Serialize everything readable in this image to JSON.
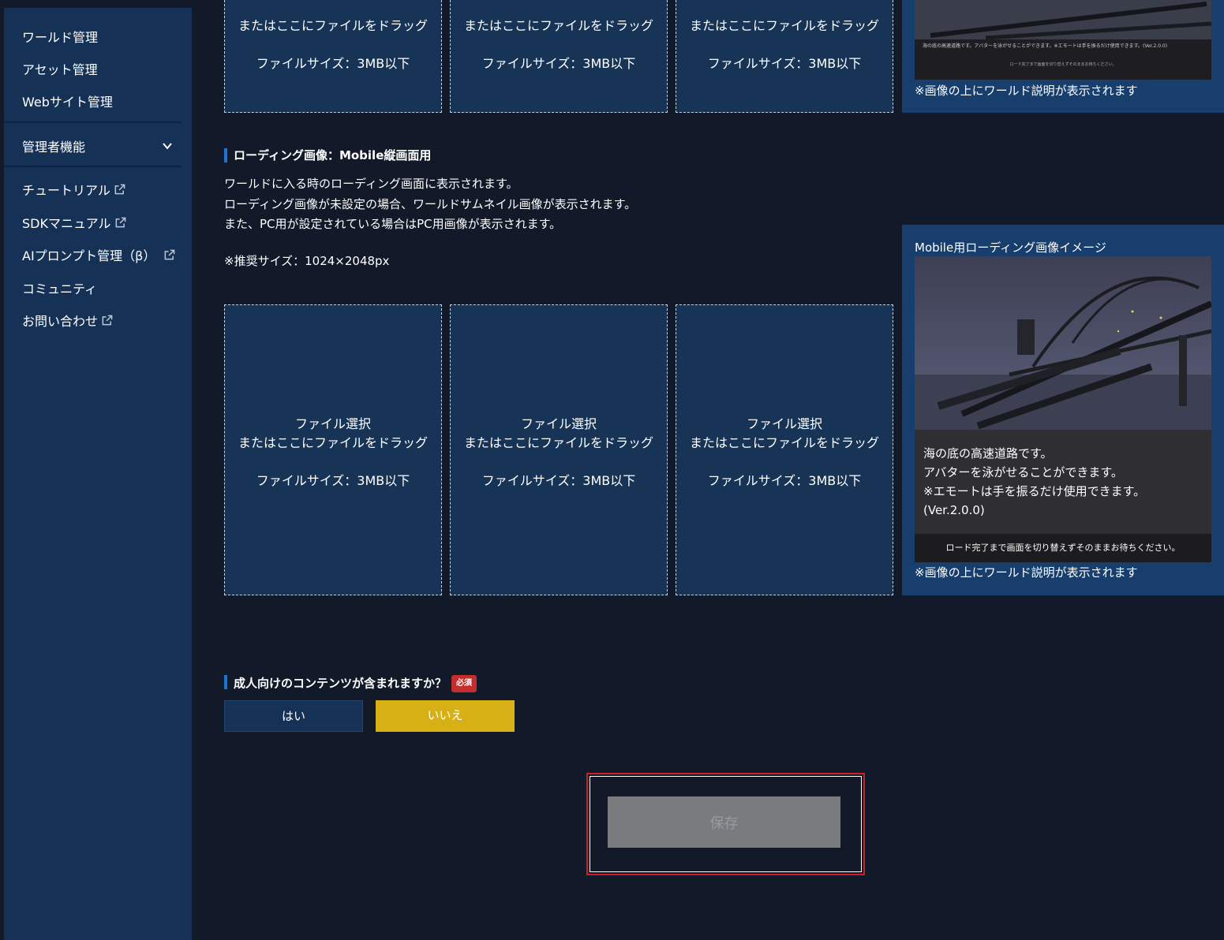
{
  "sidebar": {
    "items": [
      {
        "label": "ワールド管理"
      },
      {
        "label": "アセット管理"
      },
      {
        "label": "Webサイト管理"
      },
      {
        "label": "管理者機能"
      },
      {
        "label": "チュートリアル"
      },
      {
        "label": "SDKマニュアル"
      },
      {
        "label": "AIプロンプト管理（β）"
      },
      {
        "label": "コミュニティ"
      },
      {
        "label": "お問い合わせ"
      }
    ]
  },
  "upload": {
    "line1": "ファイル選択",
    "line2": "またはここにファイルをドラッグ",
    "size": "ファイルサイズ：3MB以下"
  },
  "top_preview": {
    "note": "※画像の上にワールド説明が表示されます",
    "tiny_text": "海の底の高速道路です。アバターを泳がせることができます。※エモートは手を振るだけ使用できます。(Ver.2.0.0)",
    "tiny_footer": "ロード完了まで画面を切り替えずそのままお待ちください。"
  },
  "mobile_section": {
    "title": "ローディング画像：Mobile縦画面用",
    "desc1": "ワールドに入る時のローディング画面に表示されます。",
    "desc2": "ローディング画像が未設定の場合、ワールドサムネイル画像が表示されます。",
    "desc3": "また、PC用が設定されている場合はPC用画像が表示されます。",
    "recommend": "※推奨サイズ：1024×2048px"
  },
  "mobile_preview": {
    "title": "Mobile用ローディング画像イメージ",
    "line1": "海の底の高速道路です。",
    "line2": "アバターを泳がせることができます。",
    "line3": "※エモートは手を振るだけ使用できます。",
    "line4": "(Ver.2.0.0)",
    "footer": "ロード完了まで画面を切り替えずそのままお待ちください。",
    "note": "※画像の上にワールド説明が表示されます"
  },
  "adult": {
    "question": "成人向けのコンテンツが含まれますか？",
    "badge": "必須",
    "yes": "はい",
    "no": "いいえ",
    "selected": "no"
  },
  "save_label": "保存",
  "colors": {
    "background": "#121a29",
    "sidebar": "#163156",
    "upload_box": "#173457",
    "selected_choice": "#d6b014",
    "save_disabled": "#7a7b7f",
    "highlight_border": "#cc1f26"
  }
}
